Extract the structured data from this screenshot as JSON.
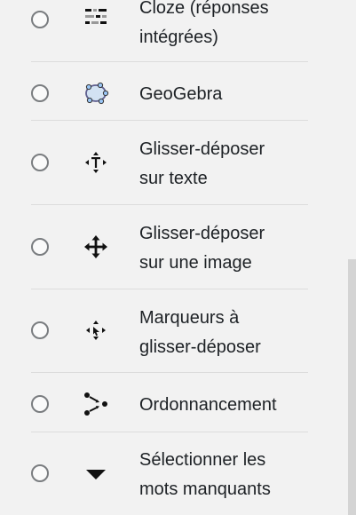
{
  "question_types": [
    {
      "label_lines": [
        "Cloze (réponses",
        "intégrées)"
      ],
      "icon": "cloze-icon"
    },
    {
      "label_lines": [
        "GeoGebra"
      ],
      "icon": "geogebra-icon"
    },
    {
      "label_lines": [
        "Glisser-déposer",
        "sur texte"
      ],
      "icon": "drag-drop-text-icon"
    },
    {
      "label_lines": [
        "Glisser-déposer",
        "sur une image"
      ],
      "icon": "drag-drop-image-icon"
    },
    {
      "label_lines": [
        "Marqueurs à",
        "glisser-déposer"
      ],
      "icon": "drag-drop-markers-icon"
    },
    {
      "label_lines": [
        "Ordonnancement"
      ],
      "icon": "ordering-icon"
    },
    {
      "label_lines": [
        "Sélectionner les",
        "mots manquants"
      ],
      "icon": "select-missing-words-icon"
    }
  ],
  "colors": {
    "background": "#f2f2f2",
    "text": "#1d2125",
    "radio_border": "#7a7d80",
    "divider": "#dcdcdc",
    "geogebra_fill": "#99c5f5",
    "geogebra_stroke": "#5f5f8f"
  }
}
